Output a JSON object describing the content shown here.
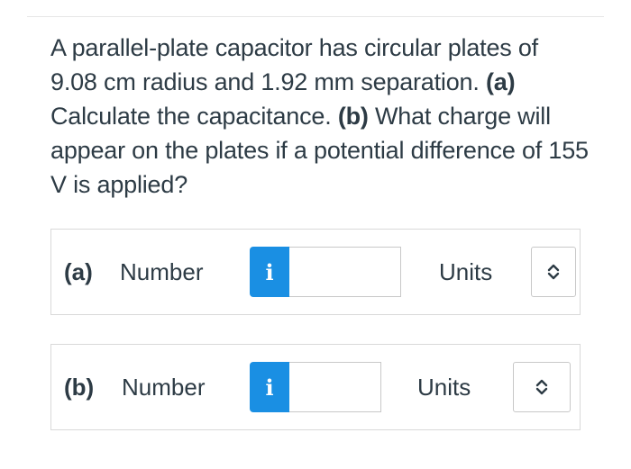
{
  "question": {
    "text_1": "A parallel-plate capacitor has circular plates of 9.08 cm radius and 1.92 mm separation. ",
    "part_a_marker": "(a)",
    "text_2": " Calculate the capacitance. ",
    "part_b_marker": "(b)",
    "text_3": " What charge will appear on the plates if a potential difference of 155 V is applied?"
  },
  "answers": {
    "a": {
      "part_label": "(a)",
      "number_label": "Number",
      "info_glyph": "i",
      "number_value": "",
      "units_label": "Units",
      "units_value": ""
    },
    "b": {
      "part_label": "(b)",
      "number_label": "Number",
      "info_glyph": "i",
      "number_value": "",
      "units_label": "Units",
      "units_value": ""
    }
  },
  "colors": {
    "info_button": "#1a8fe3",
    "text": "#2d3b45",
    "border": "#d9d9d9"
  },
  "icons": {
    "info": "info-icon",
    "select": "chevron-up-down-icon"
  }
}
